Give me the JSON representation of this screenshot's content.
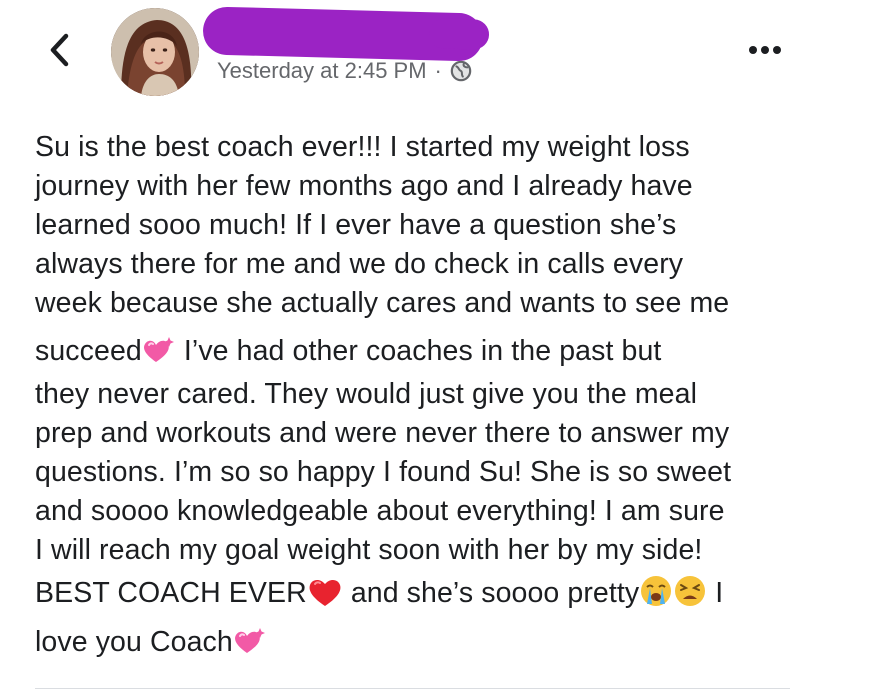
{
  "header": {
    "back_icon": "chevron-left-icon",
    "timestamp": "Yesterday at 2:45 PM",
    "separator": "·",
    "privacy_icon": "globe-icon",
    "more_icon": "more-horizontal-icon",
    "redaction_color": "#9b23c4"
  },
  "post": {
    "lines": [
      "Su is the best coach ever!!! I started my weight loss",
      "journey with her few months ago and I already have",
      "learned sooo much! If I ever have a question she’s",
      "always there for me and we do check in calls every",
      "week because she actually cares and wants to see me",
      "succeed",
      " I’ve had other coaches in the past but",
      "they never cared. They would just give you the meal",
      "prep and workouts and were never there to answer my",
      "questions. I’m so so happy I found Su! She is so sweet",
      "and soooo knowledgeable about everything! I am sure",
      "I will reach my goal weight soon with her by my side!",
      "BEST COACH EVER",
      " and she’s soooo pretty",
      " I",
      "love you Coach"
    ],
    "emojis": [
      "sparkling-heart-icon",
      "red-heart-icon",
      "loudly-crying-face-icon",
      "tired-face-icon",
      "sparkling-heart-icon"
    ]
  }
}
